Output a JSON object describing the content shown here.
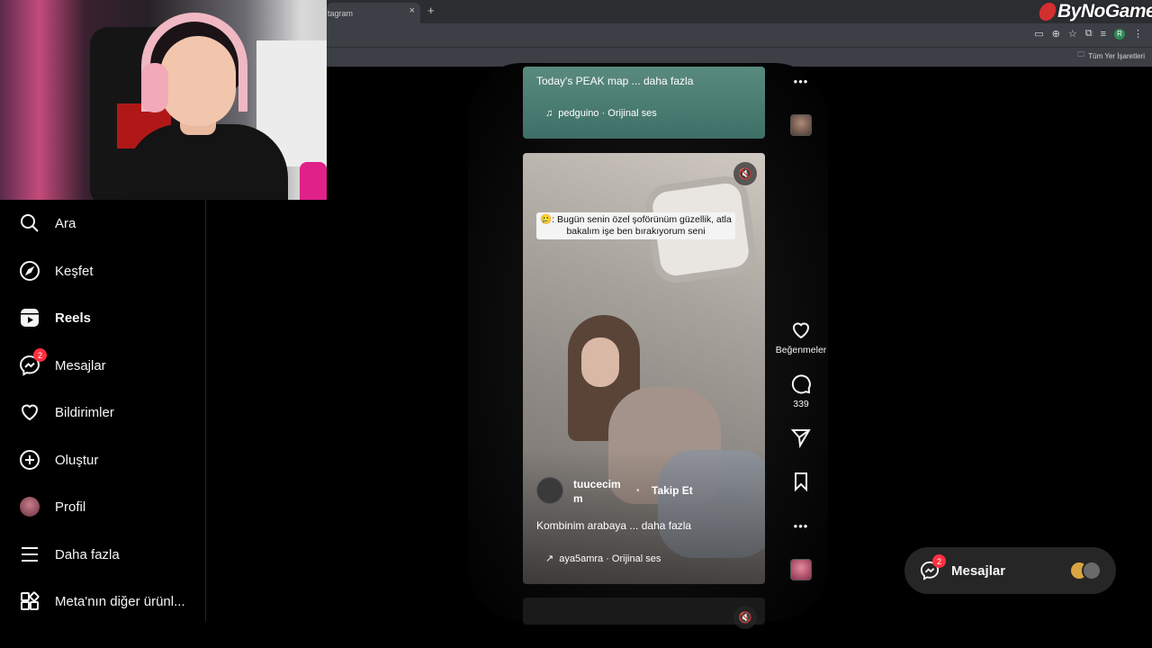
{
  "browser": {
    "tab_title": "tagram",
    "tab_close": "×",
    "new_tab": "+",
    "bookmarks_all": "Tüm Yer İşaretleri",
    "profile_initial": "R"
  },
  "watermark": {
    "text": "ByNoGame"
  },
  "sidebar": {
    "items": [
      {
        "label": "Ara",
        "icon": "search-icon"
      },
      {
        "label": "Keşfet",
        "icon": "compass-icon"
      },
      {
        "label": "Reels",
        "icon": "reels-icon"
      },
      {
        "label": "Mesajlar",
        "icon": "messenger-icon",
        "badge": "2"
      },
      {
        "label": "Bildirimler",
        "icon": "heart-icon"
      },
      {
        "label": "Oluştur",
        "icon": "plus-square-icon"
      },
      {
        "label": "Profil",
        "icon": "avatar"
      },
      {
        "label": "Daha fazla",
        "icon": "menu-icon"
      },
      {
        "label": "Meta'nın diğer ürünl...",
        "icon": "apps-icon"
      }
    ]
  },
  "reels": [
    {
      "caption": "Today's PEAK map ... daha fazla",
      "audio": "pedguino · Orijinal ses"
    },
    {
      "overlay_text": ": Bugün senin özel şoförünüm güzellik, atla bakalım işe ben bırakıyorum seni",
      "author": "tuucecimm",
      "author_line1": "tuucecim",
      "author_line2": "m",
      "separator": "•",
      "follow": "Takip Et",
      "caption": "Kombinim arabaya ... daha fazla",
      "audio": "aya5amra · Orijinal ses",
      "likes_label": "Beğenmeler",
      "comments": "339"
    }
  ],
  "actions": {
    "more": "•••"
  },
  "messages_pill": {
    "label": "Mesajlar",
    "badge": "2"
  },
  "colors": {
    "badge": "#ff3040",
    "background": "#000000",
    "pill": "#262626"
  }
}
